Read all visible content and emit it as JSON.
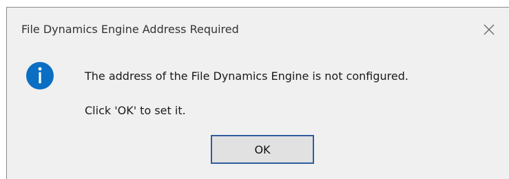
{
  "dialog": {
    "title": "File Dynamics Engine Address Required",
    "close_icon": "close-icon",
    "icon": "info-icon",
    "message": "The address of the File Dynamics Engine is not configured.",
    "instruction": "Click 'OK' to set it.",
    "ok_label": "OK"
  },
  "colors": {
    "dialog_background": "#f0f0f0",
    "info_icon": "#0a6fc2",
    "button_border": "#2e5c9e",
    "button_background": "#e1e1e1"
  }
}
